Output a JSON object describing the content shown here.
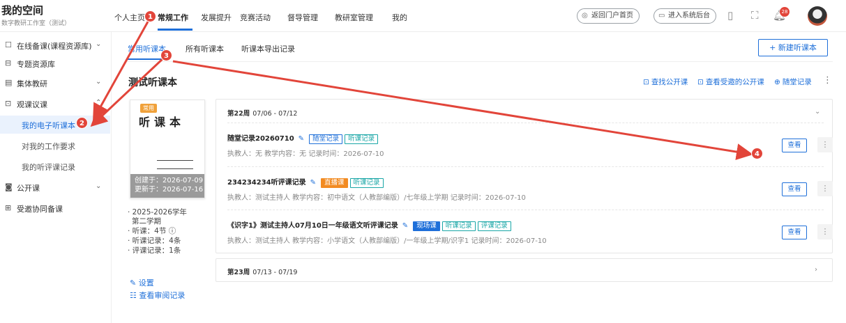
{
  "brand": {
    "title": "我的空间",
    "subtitle": "数字教研工作室（测试）"
  },
  "nav": {
    "items": [
      "个人主页",
      "常规工作",
      "发展提升",
      "竞赛活动",
      "督导管理",
      "教研室管理",
      "我的"
    ],
    "active": "常规工作",
    "portal_button": "返回门户首页",
    "admin_button": "进入系统后台",
    "notification_count": "28"
  },
  "sidebar": {
    "items": [
      {
        "label": "在线备课(课程资源库)",
        "icon": "calendar-icon",
        "arrow": "⌄"
      },
      {
        "label": "专题资源库",
        "icon": "bookmark-icon",
        "arrow": ""
      },
      {
        "label": "集体教研",
        "icon": "book-icon",
        "arrow": "⌄"
      },
      {
        "label": "观课议课",
        "icon": "classroom-icon",
        "arrow": "⌃"
      }
    ],
    "sub_items": [
      "我的电子听课本",
      "对我的工作要求",
      "我的听评课记录"
    ],
    "active_sub": "我的电子听课本",
    "items2": [
      {
        "label": "公开课",
        "icon": "video-icon",
        "arrow": "⌄"
      },
      {
        "label": "受邀协同备课",
        "icon": "people-icon",
        "arrow": ""
      }
    ]
  },
  "tabs": [
    "常用听课本",
    "所有听课本",
    "听课本导出记录"
  ],
  "new_button": "+ 新建听课本",
  "page_title": "测试听课本",
  "header_links": [
    "查找公开课",
    "查看受邀的公开课",
    "随堂记录"
  ],
  "cover": {
    "tag": "常用",
    "title": "听课本",
    "created": "创建于：2026-07-09",
    "updated": "更新于：2026-07-16"
  },
  "stats": [
    "· 2025-2026学年",
    "  第二学期",
    "· 听课：4节 ⓘ",
    "· 听课记录：4条",
    "· 评课记录：1条"
  ],
  "links": {
    "settings": "设置",
    "audit": "查看审阅记录"
  },
  "weeks": [
    {
      "label": "第22周",
      "range": "07/06 - 07/12",
      "expanded": true,
      "records": [
        {
          "title": "随堂记录20260710",
          "tags": [
            {
              "text": "随堂记录",
              "style": "blue"
            },
            {
              "text": "听课记录",
              "style": "teal"
            }
          ],
          "meta": "执教人：无    教学内容：无    记录时间：2026-07-10"
        },
        {
          "title": "234234234听评课记录",
          "tags": [
            {
              "text": "直播课",
              "style": "orange"
            },
            {
              "text": "听课记录",
              "style": "teal"
            }
          ],
          "meta": "执教人：测试主持人    教学内容：初中语文（人教部编版）/七年级上学期    记录时间：2026-07-10"
        },
        {
          "title": "《识字1》测试主持人07月10日一年级语文听评课记录",
          "tags": [
            {
              "text": "现场课",
              "style": "blue-solid"
            },
            {
              "text": "听课记录",
              "style": "teal"
            },
            {
              "text": "评课记录",
              "style": "teal"
            }
          ],
          "meta": "执教人：测试主持人    教学内容：小学语文（人教部编版）/一年级上学期/识字1    记录时间：2026-07-10"
        }
      ]
    },
    {
      "label": "第23周",
      "range": "07/13 - 07/19",
      "expanded": false,
      "records": []
    }
  ],
  "view_label": "查看",
  "annotations": [
    "1",
    "2",
    "3",
    "4"
  ],
  "colors": {
    "accent": "#1e6fd9",
    "annotation": "#e2453a",
    "tag_orange": "#f28b22",
    "tag_teal": "#18a6a6",
    "cover_tag": "#f0a13a"
  }
}
